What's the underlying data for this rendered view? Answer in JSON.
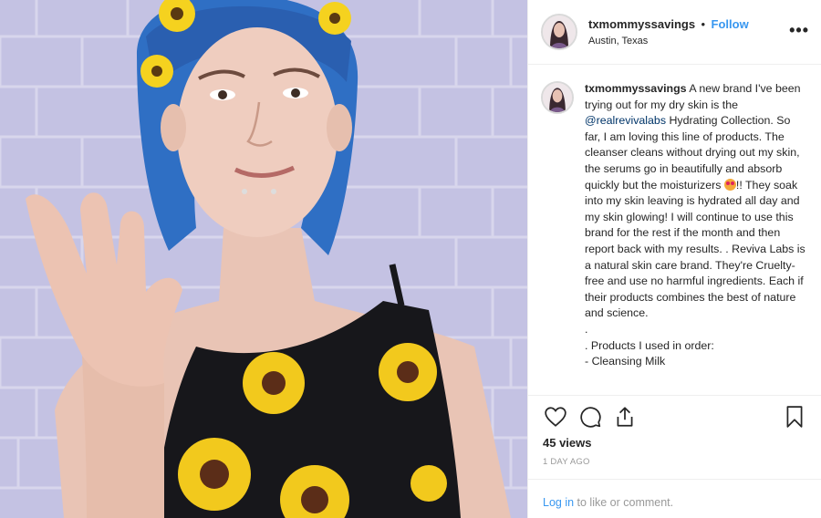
{
  "post": {
    "username": "txmommyssavings",
    "dot": "•",
    "follow_label": "Follow",
    "location": "Austin, Texas",
    "more_label": "•••"
  },
  "caption": {
    "username": "txmommyssavings",
    "text_1": " A new brand I've been trying out for my dry skin is the ",
    "mention": "@realrevivalabs",
    "text_2": " Hydrating Collection. So far, I am loving this line of products. The cleanser cleans without drying out my skin, the serums go in beautifully and absorb quickly but the moisturizers ",
    "text_3": "!! They soak into my skin leaving is hydrated all day and my skin glowing! I will continue to use this brand for the rest if the month and then report back with my results. . Reviva Labs is a natural skin care brand. They're Cruelty-free and use no harmful ingredients. Each if their products combines the best of nature and science.",
    "line_dot": ".",
    "line_products": ". Products I used in order:",
    "line_cleansing": "- Cleansing Milk"
  },
  "icons": {
    "like": "heart-icon",
    "comment": "comment-icon",
    "share": "share-icon",
    "save": "bookmark-icon",
    "emoji": "heart-eyes-emoji"
  },
  "stats": {
    "views": "45 views",
    "time": "1 DAY AGO"
  },
  "footer": {
    "login": "Log in",
    "rest": " to like or comment."
  },
  "colors": {
    "link_blue": "#3897f0",
    "mention_blue": "#003569",
    "muted_gray": "#999999",
    "border": "#efefef"
  }
}
